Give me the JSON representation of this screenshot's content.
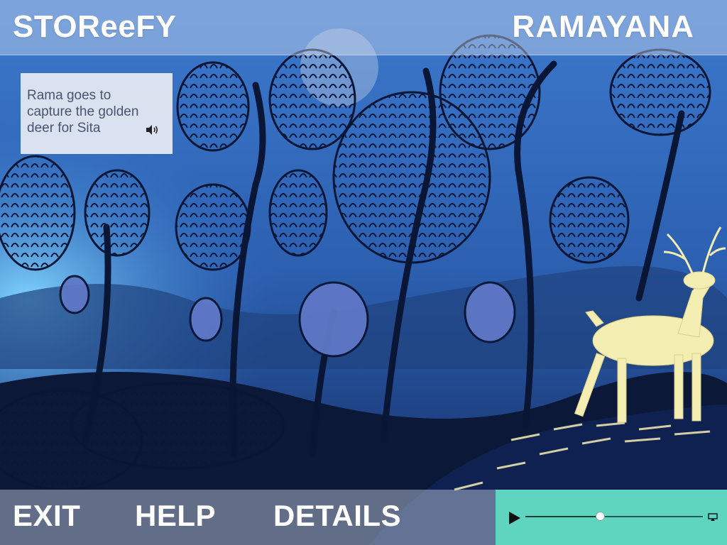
{
  "app": {
    "brand": "STOReeFY",
    "story_title": "RAMAYANA"
  },
  "caption": {
    "text": "Rama goes to capture the golden deer for Sita",
    "audio_icon": "speaker-icon"
  },
  "nav": {
    "exit_label": "EXIT",
    "help_label": "HELP",
    "details_label": "DETAILS"
  },
  "player": {
    "play_icon": "play-icon",
    "airplay_icon": "airplay-icon",
    "progress": 0.42
  },
  "colors": {
    "bar_overlay": "#d7e1f0",
    "player_bg": "#5fd4be",
    "text": "#ffffff",
    "deer": "#f4eeb2",
    "sky": "#2f6fc4"
  },
  "scene": {
    "illustration": "night forest with golden deer"
  }
}
